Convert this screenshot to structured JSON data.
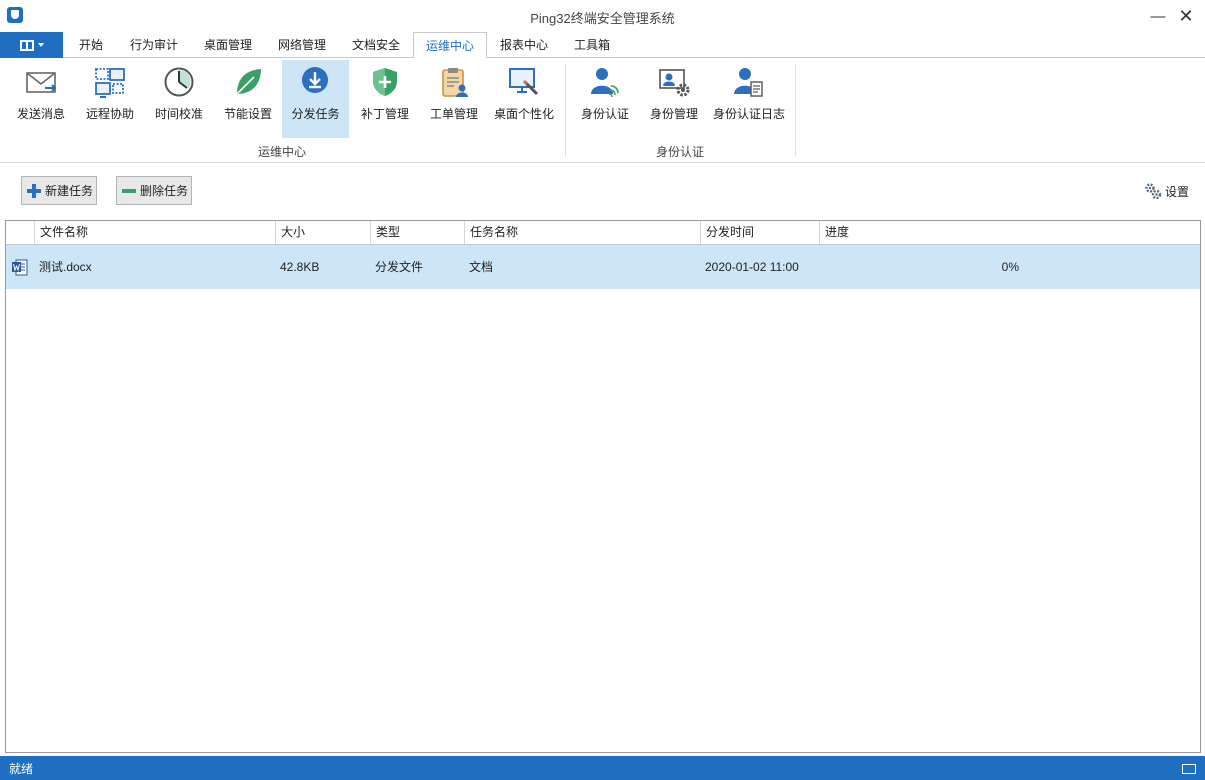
{
  "window": {
    "title": "Ping32终端安全管理系统",
    "minimize_glyph": "—",
    "close_glyph": "✕"
  },
  "menu": {
    "tabs": [
      {
        "label": "开始"
      },
      {
        "label": "行为审计"
      },
      {
        "label": "桌面管理"
      },
      {
        "label": "网络管理"
      },
      {
        "label": "文档安全"
      },
      {
        "label": "运维中心"
      },
      {
        "label": "报表中心"
      },
      {
        "label": "工具箱"
      }
    ],
    "active_tab": "运维中心"
  },
  "ribbon": {
    "groups": [
      {
        "label": "运维中心"
      },
      {
        "label": "身份认证"
      }
    ],
    "buttons": [
      {
        "label": "发送消息",
        "icon": "envelope-icon"
      },
      {
        "label": "远程协助",
        "icon": "remote-desktop-icon"
      },
      {
        "label": "时间校准",
        "icon": "clock-icon"
      },
      {
        "label": "节能设置",
        "icon": "leaf-icon"
      },
      {
        "label": "分发任务",
        "icon": "download-icon"
      },
      {
        "label": "补丁管理",
        "icon": "shield-icon"
      },
      {
        "label": "工单管理",
        "icon": "clipboard-icon"
      },
      {
        "label": "桌面个性化",
        "icon": "monitor-brush-icon"
      },
      {
        "label": "身份认证",
        "icon": "user-fingerprint-icon"
      },
      {
        "label": "身份管理",
        "icon": "user-gear-icon"
      },
      {
        "label": "身份认证日志",
        "icon": "user-document-icon"
      }
    ],
    "selected_button": "分发任务"
  },
  "toolbar": {
    "new_task_label": "新建任务",
    "delete_task_label": "删除任务",
    "settings_label": "设置"
  },
  "grid": {
    "columns": [
      "文件名称",
      "大小",
      "类型",
      "任务名称",
      "分发时间",
      "进度"
    ],
    "rows": [
      {
        "icon": "word-document-icon",
        "file_name": "测试.docx",
        "size": "42.8KB",
        "type": "分发文件",
        "task_name": "文档",
        "time": "2020-01-02 11:00",
        "progress": "0%",
        "selected": true
      }
    ]
  },
  "statusbar": {
    "text": "就绪"
  },
  "colors": {
    "accent": "#1e6fc1",
    "selection": "#cde6f7",
    "statusbar": "#1e6fc1"
  }
}
